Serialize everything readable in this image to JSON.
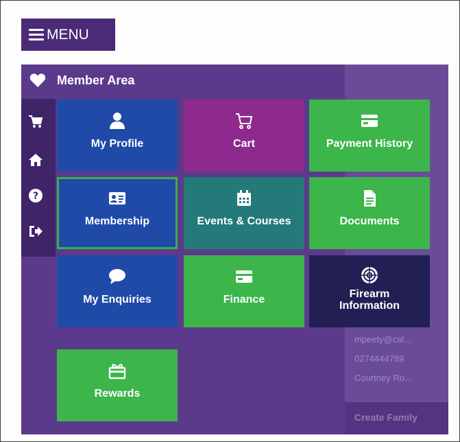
{
  "menu_button": {
    "label": "MENU"
  },
  "panel": {
    "title": "Member Area",
    "sidebar": [
      {
        "name": "cart-icon"
      },
      {
        "name": "home-icon"
      },
      {
        "name": "help-icon"
      },
      {
        "name": "logout-icon"
      }
    ],
    "tiles": [
      {
        "label": "My Profile",
        "icon": "user-icon",
        "color": "#1f4aa8"
      },
      {
        "label": "Cart",
        "icon": "cart-icon",
        "color": "#8e2a8e"
      },
      {
        "label": "Payment History",
        "icon": "card-icon",
        "color": "#3cb54b"
      },
      {
        "label": "Membership",
        "icon": "id-card-icon",
        "color": "#1f4aa8"
      },
      {
        "label": "Events & Courses",
        "icon": "calendar-icon",
        "color": "#237a78"
      },
      {
        "label": "Documents",
        "icon": "document-icon",
        "color": "#3cb54b"
      },
      {
        "label": "My Enquiries",
        "icon": "chat-icon",
        "color": "#1f4aa8"
      },
      {
        "label": "Finance",
        "icon": "card-icon",
        "color": "#3cb54b"
      },
      {
        "label": "Firearm Information",
        "icon": "target-icon",
        "color": "#221f55"
      },
      {
        "label": "Rewards",
        "icon": "gift-icon",
        "color": "#3cb54b"
      }
    ]
  },
  "background_page": {
    "contact_lines": [
      "mpeety@cal...",
      "0274444789",
      "Courtney Ro..."
    ],
    "create_button": "Create Family"
  }
}
